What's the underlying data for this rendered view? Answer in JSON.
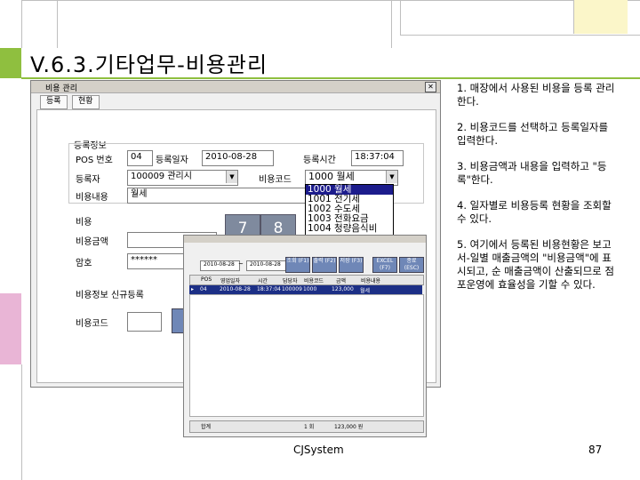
{
  "slide": {
    "title": "V.6.3.기타업무-비용관리",
    "footer": "CJSystem",
    "page_number": "87",
    "accent_color": "#8fbf3f"
  },
  "window": {
    "title": "비용 관리",
    "close_icon": "close-icon",
    "tabs": [
      "등록",
      "현황"
    ],
    "section_label": "등록정보",
    "pos_label": "POS 번호",
    "pos_value": "04",
    "reg_date_label": "등록일자",
    "reg_date_value": "2010-08-28",
    "reg_time_label": "등록시간",
    "reg_time_value": "18:37:04",
    "registrar_label": "등록자",
    "registrar_value": "100009 관리시",
    "cost_code_label": "비용코드",
    "cost_code_value": "1000 월세",
    "cost_content_label": "비용내용",
    "cost_content_value": "월세",
    "cost_section_label": "비용",
    "cost_amount_label": "비용금액",
    "password_label": "암호",
    "password_value": "******",
    "cost_info_label": "비용정보 신규등록",
    "cost_code2_label": "비용코드",
    "dropdown_items": [
      "1000 월세",
      "1001 전기세",
      "1002 수도세",
      "1003 전화요금",
      "1004 청량음식비"
    ],
    "keypad": [
      "7",
      "8"
    ]
  },
  "overlay": {
    "date_from": "2010-08-28",
    "date_to": "2010-08-28",
    "buttons": [
      "조회 (F1)",
      "출력 (F2)",
      "저장 (F3)",
      "EXCEL (F7)",
      "종료 (ESC)"
    ],
    "columns": [
      "POS",
      "영업일자",
      "시간",
      "담당자",
      "비용코드",
      "금액",
      "비용내용"
    ],
    "row": [
      "04",
      "2010-08-28",
      "18:37:04",
      "100009",
      "1000",
      "123,000",
      "월세"
    ],
    "footer_label": "합계",
    "footer_count": "1 회",
    "footer_amount": "123,000 원"
  },
  "notes": [
    "1. 매장에서 사용된 비용을 등록 관리한다.",
    "2. 비용코드를 선택하고 등록일자를 입력한다.",
    "3. 비용금액과 내용을 입력하고 \"등록\"한다.",
    "4. 일자별로 비용등록 현황을 조회할 수 있다.",
    "5. 여기에서 등록된 비용현황은 보고서-일별 매출금액의 \"비용금액\"에 표시되고, 순 매출금액이 산출되므로 점포운영에 효율성을 기할 수 있다."
  ]
}
